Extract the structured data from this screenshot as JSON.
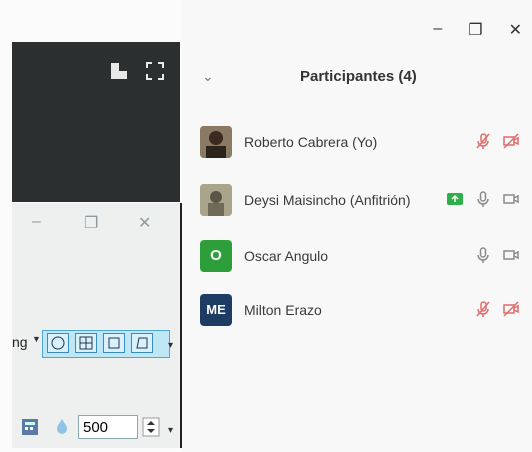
{
  "window": {
    "minimize_icon": "minimize-icon",
    "restore_icon": "restore-icon",
    "close_icon": "close-icon"
  },
  "panel": {
    "title": "Participantes (4)",
    "collapse_icon": "chevron-down-icon"
  },
  "participants": [
    {
      "name": "Roberto Cabrera (Yo)",
      "avatar": {
        "type": "photo"
      },
      "audio": "muted",
      "video": "off",
      "host": false
    },
    {
      "name": "Deysi Maisincho (Anfitrión)",
      "avatar": {
        "type": "photo"
      },
      "audio": "on",
      "video": "on",
      "host": true
    },
    {
      "name": "Oscar Angulo",
      "avatar": {
        "type": "initials",
        "text": "O",
        "color": "#2e9e3a"
      },
      "audio": "on",
      "video": "on",
      "host": false
    },
    {
      "name": "Milton Erazo",
      "avatar": {
        "type": "initials",
        "text": "ME",
        "color": "#1e3b63"
      },
      "audio": "muted",
      "video": "off",
      "host": false
    }
  ],
  "left_pane": {
    "video_buttons": [
      "view-toggle-icon",
      "fullscreen-icon"
    ],
    "bg_window": {
      "label_fragment": "ng",
      "zoom_value": "500"
    }
  },
  "colors": {
    "muted_red": "#e06b6b",
    "host_green": "#2daf4a",
    "icon_gray": "#8a8a8a"
  }
}
